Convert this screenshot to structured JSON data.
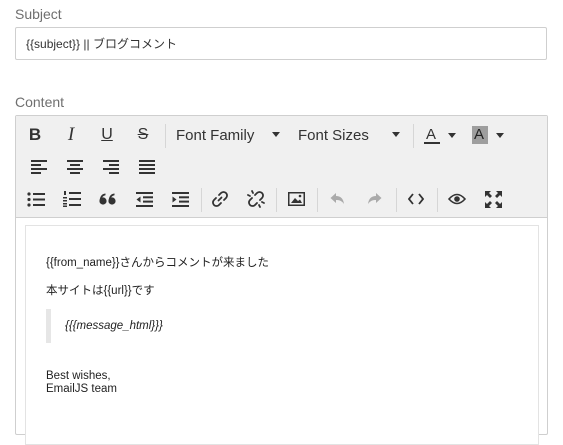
{
  "subject": {
    "label": "Subject",
    "value": "{{subject}} || ブログコメント"
  },
  "content": {
    "label": "Content"
  },
  "toolbar": {
    "font_family": "Font Family",
    "font_sizes": "Font Sizes",
    "font_color_glyph": "A",
    "background_color_glyph": "A",
    "strikethrough_glyph": "S",
    "bold_glyph": "B",
    "italic_glyph": "I",
    "underline_glyph": "U"
  },
  "body": {
    "line1": "{{from_name}}さんからコメントが来ました",
    "line2": "本サイトは{{url}}です",
    "quote": "{{{message_html}}}",
    "sign1": "Best wishes,",
    "sign2": "EmailJS team"
  },
  "colors": {
    "toolbar_bg": "#f0f0f0",
    "border": "#cfcfcf",
    "label": "#6f6f6f",
    "background_color_swatch": "#9e9e9e"
  }
}
